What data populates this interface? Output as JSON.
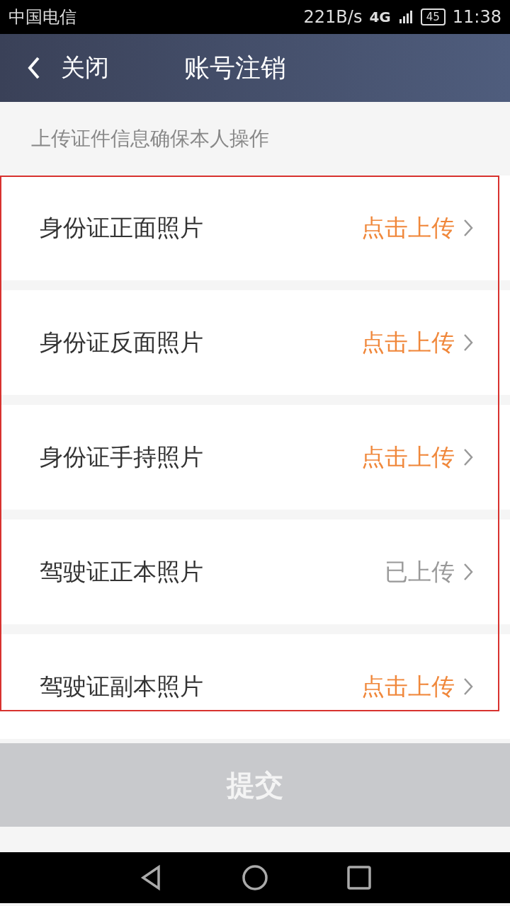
{
  "status_bar": {
    "carrier": "中国电信",
    "speed": "221B/s",
    "network": "4G",
    "battery": "45",
    "time": "11:38"
  },
  "nav": {
    "back_label": "关闭",
    "title": "账号注销"
  },
  "hint": "上传证件信息确保本人操作",
  "items": [
    {
      "label": "身份证正面照片",
      "status": "点击上传",
      "uploaded": false
    },
    {
      "label": "身份证反面照片",
      "status": "点击上传",
      "uploaded": false
    },
    {
      "label": "身份证手持照片",
      "status": "点击上传",
      "uploaded": false
    },
    {
      "label": "驾驶证正本照片",
      "status": "已上传",
      "uploaded": true
    },
    {
      "label": "驾驶证副本照片",
      "status": "点击上传",
      "uploaded": false
    }
  ],
  "highlight": {
    "shown": true
  },
  "submit": {
    "label": "提交",
    "disabled": true
  }
}
